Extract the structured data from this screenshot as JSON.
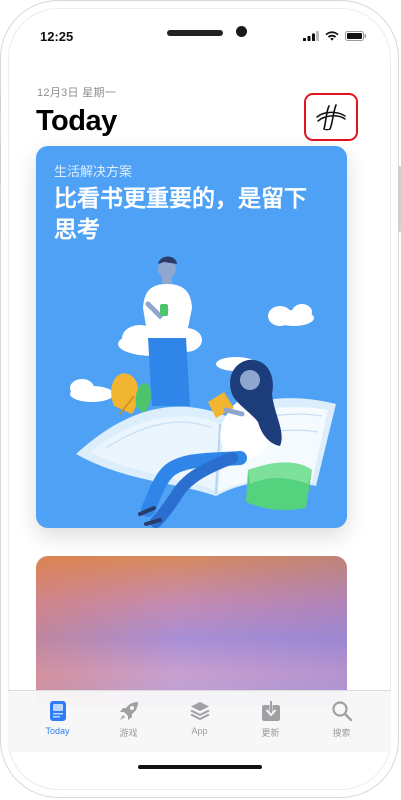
{
  "status_bar": {
    "time": "12:25"
  },
  "header": {
    "date": "12月3日 星期一",
    "title": "Today"
  },
  "featured_card": {
    "eyebrow": "生活解决方案",
    "headline": "比看书更重要的，是留下思考"
  },
  "tabbar": {
    "accent": "#2f7cf6",
    "items": [
      {
        "label": "Today",
        "icon": "today-icon",
        "active": true
      },
      {
        "label": "游戏",
        "icon": "rocket-icon",
        "active": false
      },
      {
        "label": "App",
        "icon": "layers-icon",
        "active": false
      },
      {
        "label": "更新",
        "icon": "download-icon",
        "active": false
      },
      {
        "label": "搜索",
        "icon": "search-icon",
        "active": false
      }
    ]
  }
}
